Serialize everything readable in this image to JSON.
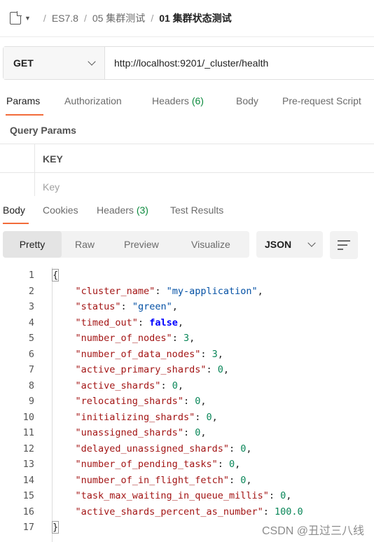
{
  "breadcrumb": {
    "items": [
      "ES7.8",
      "05 集群测试",
      "01 集群状态测试"
    ],
    "separator": "/"
  },
  "request": {
    "method": "GET",
    "url": "http://localhost:9201/_cluster/health"
  },
  "request_tabs": {
    "params": "Params",
    "authorization": "Authorization",
    "headers": "Headers",
    "headers_count": "(6)",
    "body": "Body",
    "pre_request": "Pre-request Script"
  },
  "query_params": {
    "title": "Query Params",
    "column_key": "KEY",
    "placeholder_key": "Key"
  },
  "response_tabs": {
    "body": "Body",
    "cookies": "Cookies",
    "headers": "Headers",
    "headers_count": "(3)",
    "test_results": "Test Results"
  },
  "view_modes": {
    "pretty": "Pretty",
    "raw": "Raw",
    "preview": "Preview",
    "visualize": "Visualize"
  },
  "format": "JSON",
  "response_lines": [
    {
      "num": "1",
      "open": "{"
    },
    {
      "num": "2",
      "key": "\"cluster_name\"",
      "value": "\"my-application\"",
      "vtype": "s",
      "trail": ","
    },
    {
      "num": "3",
      "key": "\"status\"",
      "value": "\"green\"",
      "vtype": "s",
      "trail": ","
    },
    {
      "num": "4",
      "key": "\"timed_out\"",
      "value": "false",
      "vtype": "b",
      "trail": ","
    },
    {
      "num": "5",
      "key": "\"number_of_nodes\"",
      "value": "3",
      "vtype": "n",
      "trail": ","
    },
    {
      "num": "6",
      "key": "\"number_of_data_nodes\"",
      "value": "3",
      "vtype": "n",
      "trail": ","
    },
    {
      "num": "7",
      "key": "\"active_primary_shards\"",
      "value": "0",
      "vtype": "n",
      "trail": ","
    },
    {
      "num": "8",
      "key": "\"active_shards\"",
      "value": "0",
      "vtype": "n",
      "trail": ","
    },
    {
      "num": "9",
      "key": "\"relocating_shards\"",
      "value": "0",
      "vtype": "n",
      "trail": ","
    },
    {
      "num": "10",
      "key": "\"initializing_shards\"",
      "value": "0",
      "vtype": "n",
      "trail": ","
    },
    {
      "num": "11",
      "key": "\"unassigned_shards\"",
      "value": "0",
      "vtype": "n",
      "trail": ","
    },
    {
      "num": "12",
      "key": "\"delayed_unassigned_shards\"",
      "value": "0",
      "vtype": "n",
      "trail": ","
    },
    {
      "num": "13",
      "key": "\"number_of_pending_tasks\"",
      "value": "0",
      "vtype": "n",
      "trail": ","
    },
    {
      "num": "14",
      "key": "\"number_of_in_flight_fetch\"",
      "value": "0",
      "vtype": "n",
      "trail": ","
    },
    {
      "num": "15",
      "key": "\"task_max_waiting_in_queue_millis\"",
      "value": "0",
      "vtype": "n",
      "trail": ","
    },
    {
      "num": "16",
      "key": "\"active_shards_percent_as_number\"",
      "value": "100.0",
      "vtype": "n",
      "trail": ""
    },
    {
      "num": "17",
      "close": "}"
    }
  ],
  "watermark": "CSDN @丑过三八线",
  "colors": {
    "accent": "#f26b3a",
    "count_green": "#0c8a3d",
    "json_key": "#a31515",
    "json_string": "#0451a5",
    "json_number": "#098658",
    "json_boolean": "#0000ff"
  }
}
